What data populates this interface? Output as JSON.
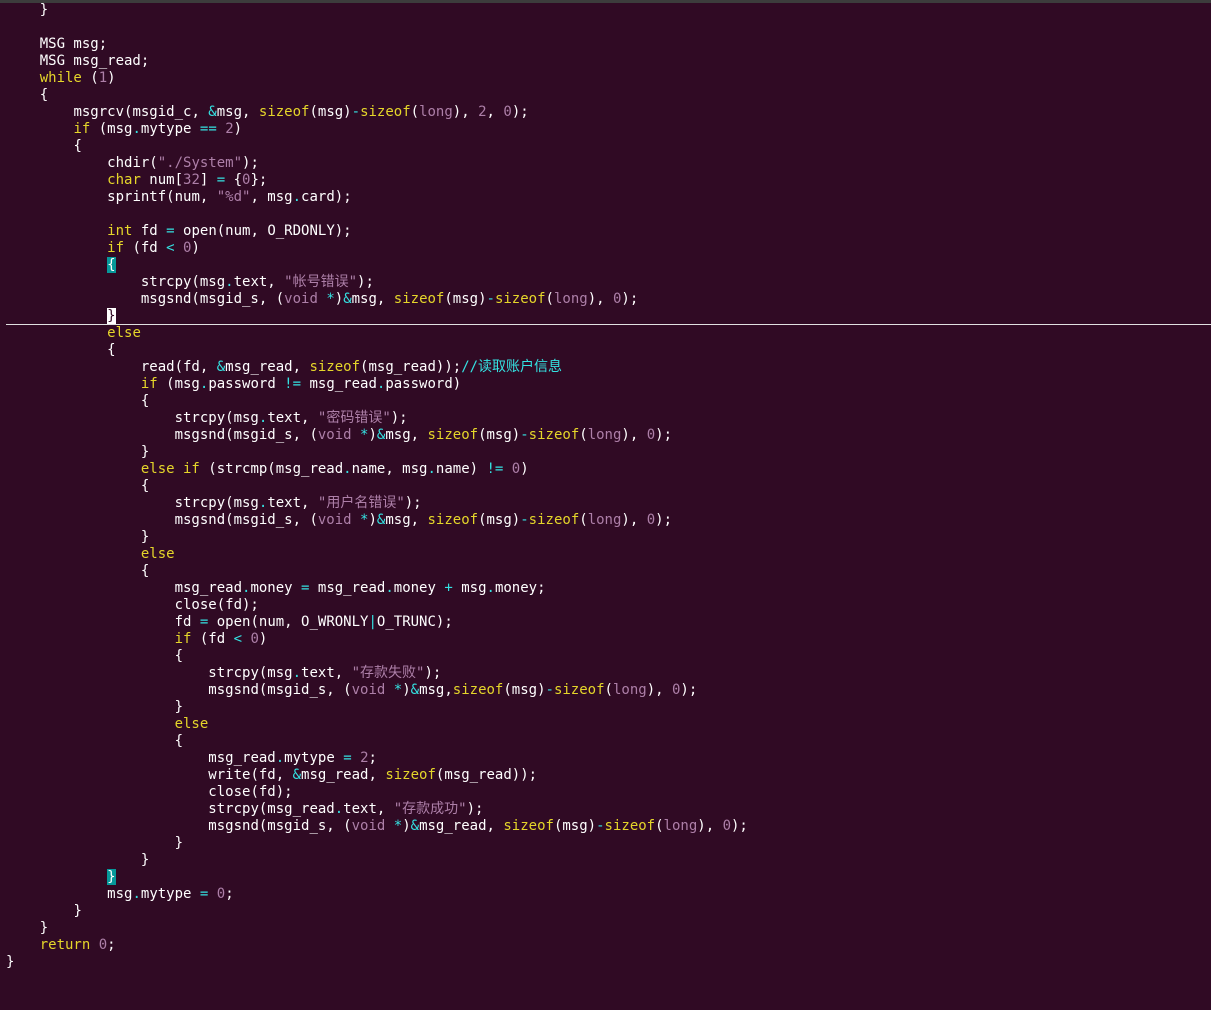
{
  "editor": {
    "theme": {
      "background": "#300a24",
      "keyword": "#e5d62a",
      "constant": "#ad7fa8",
      "operator": "#34e2e2",
      "text": "#ffffff",
      "matched_bracket": "#06989a"
    },
    "cursor_line_index": 18,
    "lines": [
      {
        "indent": 4,
        "tokens": [
          [
            "}",
            "id"
          ]
        ]
      },
      {
        "indent": 0,
        "tokens": []
      },
      {
        "indent": 4,
        "tokens": [
          [
            "MSG msg;",
            "id"
          ]
        ]
      },
      {
        "indent": 4,
        "tokens": [
          [
            "MSG msg_read;",
            "id"
          ]
        ]
      },
      {
        "indent": 4,
        "tokens": [
          [
            "while",
            "kw"
          ],
          [
            " (",
            "id"
          ],
          [
            "1",
            "num"
          ],
          [
            ")",
            "id"
          ]
        ]
      },
      {
        "indent": 4,
        "tokens": [
          [
            "{",
            "id"
          ]
        ]
      },
      {
        "indent": 8,
        "tokens": [
          [
            "msgrcv(msgid_c, ",
            "id"
          ],
          [
            "&",
            "op"
          ],
          [
            "msg, ",
            "id"
          ],
          [
            "sizeof",
            "kw"
          ],
          [
            "(msg)",
            "id"
          ],
          [
            "-",
            "op"
          ],
          [
            "sizeof",
            "kw"
          ],
          [
            "(",
            "id"
          ],
          [
            "long",
            "num"
          ],
          [
            "), ",
            "id"
          ],
          [
            "2",
            "num"
          ],
          [
            ", ",
            "id"
          ],
          [
            "0",
            "num"
          ],
          [
            ");",
            "id"
          ]
        ]
      },
      {
        "indent": 8,
        "tokens": [
          [
            "if",
            "kw"
          ],
          [
            " (msg",
            "id"
          ],
          [
            ".",
            "op"
          ],
          [
            "mytype ",
            "id"
          ],
          [
            "==",
            "op"
          ],
          [
            " ",
            "id"
          ],
          [
            "2",
            "num"
          ],
          [
            ")",
            "id"
          ]
        ]
      },
      {
        "indent": 8,
        "tokens": [
          [
            "{",
            "id"
          ]
        ]
      },
      {
        "indent": 12,
        "tokens": [
          [
            "chdir(",
            "id"
          ],
          [
            "\"./System\"",
            "str"
          ],
          [
            ");",
            "id"
          ]
        ]
      },
      {
        "indent": 12,
        "tokens": [
          [
            "char",
            "kw"
          ],
          [
            " num[",
            "id"
          ],
          [
            "32",
            "num"
          ],
          [
            "] ",
            "id"
          ],
          [
            "=",
            "op"
          ],
          [
            " {",
            "id"
          ],
          [
            "0",
            "num"
          ],
          [
            "};",
            "id"
          ]
        ]
      },
      {
        "indent": 12,
        "tokens": [
          [
            "sprintf(num, ",
            "id"
          ],
          [
            "\"%d\"",
            "str"
          ],
          [
            ", msg",
            "id"
          ],
          [
            ".",
            "op"
          ],
          [
            "card);",
            "id"
          ]
        ]
      },
      {
        "indent": 0,
        "tokens": []
      },
      {
        "indent": 12,
        "tokens": [
          [
            "int",
            "kw"
          ],
          [
            " fd ",
            "id"
          ],
          [
            "=",
            "op"
          ],
          [
            " open(num, O_RDONLY);",
            "id"
          ]
        ]
      },
      {
        "indent": 12,
        "tokens": [
          [
            "if",
            "kw"
          ],
          [
            " (fd ",
            "id"
          ],
          [
            "<",
            "op"
          ],
          [
            " ",
            "id"
          ],
          [
            "0",
            "num"
          ],
          [
            ")",
            "id"
          ]
        ]
      },
      {
        "indent": 12,
        "tokens": [
          [
            "{",
            "bm"
          ]
        ]
      },
      {
        "indent": 16,
        "tokens": [
          [
            "strcpy(msg",
            "id"
          ],
          [
            ".",
            "op"
          ],
          [
            "text, ",
            "id"
          ],
          [
            "\"帐号错误\"",
            "str"
          ],
          [
            ");",
            "id"
          ]
        ]
      },
      {
        "indent": 16,
        "tokens": [
          [
            "msgsnd(msgid_s, (",
            "id"
          ],
          [
            "void",
            "num"
          ],
          [
            " ",
            "id"
          ],
          [
            "*",
            "op"
          ],
          [
            ")",
            "id"
          ],
          [
            "&",
            "op"
          ],
          [
            "msg, ",
            "id"
          ],
          [
            "sizeof",
            "kw"
          ],
          [
            "(msg)",
            "id"
          ],
          [
            "-",
            "op"
          ],
          [
            "sizeof",
            "kw"
          ],
          [
            "(",
            "id"
          ],
          [
            "long",
            "num"
          ],
          [
            "), ",
            "id"
          ],
          [
            "0",
            "num"
          ],
          [
            ");",
            "id"
          ]
        ]
      },
      {
        "indent": 12,
        "tokens": [
          [
            "}",
            "cur"
          ]
        ]
      },
      {
        "indent": 12,
        "tokens": [
          [
            "else",
            "kw"
          ]
        ]
      },
      {
        "indent": 12,
        "tokens": [
          [
            "{",
            "id"
          ]
        ]
      },
      {
        "indent": 16,
        "tokens": [
          [
            "read(fd, ",
            "id"
          ],
          [
            "&",
            "op"
          ],
          [
            "msg_read, ",
            "id"
          ],
          [
            "sizeof",
            "kw"
          ],
          [
            "(msg_read));",
            "id"
          ],
          [
            "//读取账户信息",
            "cmt"
          ]
        ]
      },
      {
        "indent": 16,
        "tokens": [
          [
            "if",
            "kw"
          ],
          [
            " (msg",
            "id"
          ],
          [
            ".",
            "op"
          ],
          [
            "password ",
            "id"
          ],
          [
            "!=",
            "op"
          ],
          [
            " msg_read",
            "id"
          ],
          [
            ".",
            "op"
          ],
          [
            "password)",
            "id"
          ]
        ]
      },
      {
        "indent": 16,
        "tokens": [
          [
            "{",
            "id"
          ]
        ]
      },
      {
        "indent": 20,
        "tokens": [
          [
            "strcpy(msg",
            "id"
          ],
          [
            ".",
            "op"
          ],
          [
            "text, ",
            "id"
          ],
          [
            "\"密码错误\"",
            "str"
          ],
          [
            ");",
            "id"
          ]
        ]
      },
      {
        "indent": 20,
        "tokens": [
          [
            "msgsnd(msgid_s, (",
            "id"
          ],
          [
            "void",
            "num"
          ],
          [
            " ",
            "id"
          ],
          [
            "*",
            "op"
          ],
          [
            ")",
            "id"
          ],
          [
            "&",
            "op"
          ],
          [
            "msg, ",
            "id"
          ],
          [
            "sizeof",
            "kw"
          ],
          [
            "(msg)",
            "id"
          ],
          [
            "-",
            "op"
          ],
          [
            "sizeof",
            "kw"
          ],
          [
            "(",
            "id"
          ],
          [
            "long",
            "num"
          ],
          [
            "), ",
            "id"
          ],
          [
            "0",
            "num"
          ],
          [
            ");",
            "id"
          ]
        ]
      },
      {
        "indent": 16,
        "tokens": [
          [
            "}",
            "id"
          ]
        ]
      },
      {
        "indent": 16,
        "tokens": [
          [
            "else if",
            "kw"
          ],
          [
            " (strcmp(msg_read",
            "id"
          ],
          [
            ".",
            "op"
          ],
          [
            "name, msg",
            "id"
          ],
          [
            ".",
            "op"
          ],
          [
            "name) ",
            "id"
          ],
          [
            "!=",
            "op"
          ],
          [
            " ",
            "id"
          ],
          [
            "0",
            "num"
          ],
          [
            ")",
            "id"
          ]
        ]
      },
      {
        "indent": 16,
        "tokens": [
          [
            "{",
            "id"
          ]
        ]
      },
      {
        "indent": 20,
        "tokens": [
          [
            "strcpy(msg",
            "id"
          ],
          [
            ".",
            "op"
          ],
          [
            "text, ",
            "id"
          ],
          [
            "\"用户名错误\"",
            "str"
          ],
          [
            ");",
            "id"
          ]
        ]
      },
      {
        "indent": 20,
        "tokens": [
          [
            "msgsnd(msgid_s, (",
            "id"
          ],
          [
            "void",
            "num"
          ],
          [
            " ",
            "id"
          ],
          [
            "*",
            "op"
          ],
          [
            ")",
            "id"
          ],
          [
            "&",
            "op"
          ],
          [
            "msg, ",
            "id"
          ],
          [
            "sizeof",
            "kw"
          ],
          [
            "(msg)",
            "id"
          ],
          [
            "-",
            "op"
          ],
          [
            "sizeof",
            "kw"
          ],
          [
            "(",
            "id"
          ],
          [
            "long",
            "num"
          ],
          [
            "), ",
            "id"
          ],
          [
            "0",
            "num"
          ],
          [
            ");",
            "id"
          ]
        ]
      },
      {
        "indent": 16,
        "tokens": [
          [
            "}",
            "id"
          ]
        ]
      },
      {
        "indent": 16,
        "tokens": [
          [
            "else",
            "kw"
          ]
        ]
      },
      {
        "indent": 16,
        "tokens": [
          [
            "{",
            "id"
          ]
        ]
      },
      {
        "indent": 20,
        "tokens": [
          [
            "msg_read",
            "id"
          ],
          [
            ".",
            "op"
          ],
          [
            "money ",
            "id"
          ],
          [
            "=",
            "op"
          ],
          [
            " msg_read",
            "id"
          ],
          [
            ".",
            "op"
          ],
          [
            "money ",
            "id"
          ],
          [
            "+",
            "op"
          ],
          [
            " msg",
            "id"
          ],
          [
            ".",
            "op"
          ],
          [
            "money;",
            "id"
          ]
        ]
      },
      {
        "indent": 20,
        "tokens": [
          [
            "close(fd);",
            "id"
          ]
        ]
      },
      {
        "indent": 20,
        "tokens": [
          [
            "fd ",
            "id"
          ],
          [
            "=",
            "op"
          ],
          [
            " open(num, O_WRONLY",
            "id"
          ],
          [
            "|",
            "op"
          ],
          [
            "O_TRUNC);",
            "id"
          ]
        ]
      },
      {
        "indent": 20,
        "tokens": [
          [
            "if",
            "kw"
          ],
          [
            " (fd ",
            "id"
          ],
          [
            "<",
            "op"
          ],
          [
            " ",
            "id"
          ],
          [
            "0",
            "num"
          ],
          [
            ")",
            "id"
          ]
        ]
      },
      {
        "indent": 20,
        "tokens": [
          [
            "{",
            "id"
          ]
        ]
      },
      {
        "indent": 24,
        "tokens": [
          [
            "strcpy(msg",
            "id"
          ],
          [
            ".",
            "op"
          ],
          [
            "text, ",
            "id"
          ],
          [
            "\"存款失败\"",
            "str"
          ],
          [
            ");",
            "id"
          ]
        ]
      },
      {
        "indent": 24,
        "tokens": [
          [
            "msgsnd(msgid_s, (",
            "id"
          ],
          [
            "void",
            "num"
          ],
          [
            " ",
            "id"
          ],
          [
            "*",
            "op"
          ],
          [
            ")",
            "id"
          ],
          [
            "&",
            "op"
          ],
          [
            "msg,",
            "id"
          ],
          [
            "sizeof",
            "kw"
          ],
          [
            "(msg)",
            "id"
          ],
          [
            "-",
            "op"
          ],
          [
            "sizeof",
            "kw"
          ],
          [
            "(",
            "id"
          ],
          [
            "long",
            "num"
          ],
          [
            "), ",
            "id"
          ],
          [
            "0",
            "num"
          ],
          [
            ");",
            "id"
          ]
        ]
      },
      {
        "indent": 20,
        "tokens": [
          [
            "}",
            "id"
          ]
        ]
      },
      {
        "indent": 20,
        "tokens": [
          [
            "else",
            "kw"
          ]
        ]
      },
      {
        "indent": 20,
        "tokens": [
          [
            "{",
            "id"
          ]
        ]
      },
      {
        "indent": 24,
        "tokens": [
          [
            "msg_read",
            "id"
          ],
          [
            ".",
            "op"
          ],
          [
            "mytype ",
            "id"
          ],
          [
            "=",
            "op"
          ],
          [
            " ",
            "id"
          ],
          [
            "2",
            "num"
          ],
          [
            ";",
            "id"
          ]
        ]
      },
      {
        "indent": 24,
        "tokens": [
          [
            "write(fd, ",
            "id"
          ],
          [
            "&",
            "op"
          ],
          [
            "msg_read, ",
            "id"
          ],
          [
            "sizeof",
            "kw"
          ],
          [
            "(msg_read));",
            "id"
          ]
        ]
      },
      {
        "indent": 24,
        "tokens": [
          [
            "close(fd);",
            "id"
          ]
        ]
      },
      {
        "indent": 24,
        "tokens": [
          [
            "strcpy(msg_read",
            "id"
          ],
          [
            ".",
            "op"
          ],
          [
            "text, ",
            "id"
          ],
          [
            "\"存款成功\"",
            "str"
          ],
          [
            ");",
            "id"
          ]
        ]
      },
      {
        "indent": 24,
        "tokens": [
          [
            "msgsnd(msgid_s, (",
            "id"
          ],
          [
            "void",
            "num"
          ],
          [
            " ",
            "id"
          ],
          [
            "*",
            "op"
          ],
          [
            ")",
            "id"
          ],
          [
            "&",
            "op"
          ],
          [
            "msg_read, ",
            "id"
          ],
          [
            "sizeof",
            "kw"
          ],
          [
            "(msg)",
            "id"
          ],
          [
            "-",
            "op"
          ],
          [
            "sizeof",
            "kw"
          ],
          [
            "(",
            "id"
          ],
          [
            "long",
            "num"
          ],
          [
            "), ",
            "id"
          ],
          [
            "0",
            "num"
          ],
          [
            ");",
            "id"
          ]
        ]
      },
      {
        "indent": 20,
        "tokens": [
          [
            "}",
            "id"
          ]
        ]
      },
      {
        "indent": 16,
        "tokens": [
          [
            "}",
            "id"
          ]
        ]
      },
      {
        "indent": 12,
        "tokens": [
          [
            "}",
            "bm"
          ]
        ]
      },
      {
        "indent": 12,
        "tokens": [
          [
            "msg",
            "id"
          ],
          [
            ".",
            "op"
          ],
          [
            "mytype ",
            "id"
          ],
          [
            "=",
            "op"
          ],
          [
            " ",
            "id"
          ],
          [
            "0",
            "num"
          ],
          [
            ";",
            "id"
          ]
        ]
      },
      {
        "indent": 8,
        "tokens": [
          [
            "}",
            "id"
          ]
        ]
      },
      {
        "indent": 4,
        "tokens": [
          [
            "}",
            "id"
          ]
        ]
      },
      {
        "indent": 4,
        "tokens": [
          [
            "return",
            "kw"
          ],
          [
            " ",
            "id"
          ],
          [
            "0",
            "num"
          ],
          [
            ";",
            "id"
          ]
        ]
      },
      {
        "indent": 0,
        "tokens": [
          [
            "}",
            "id"
          ]
        ]
      }
    ]
  }
}
